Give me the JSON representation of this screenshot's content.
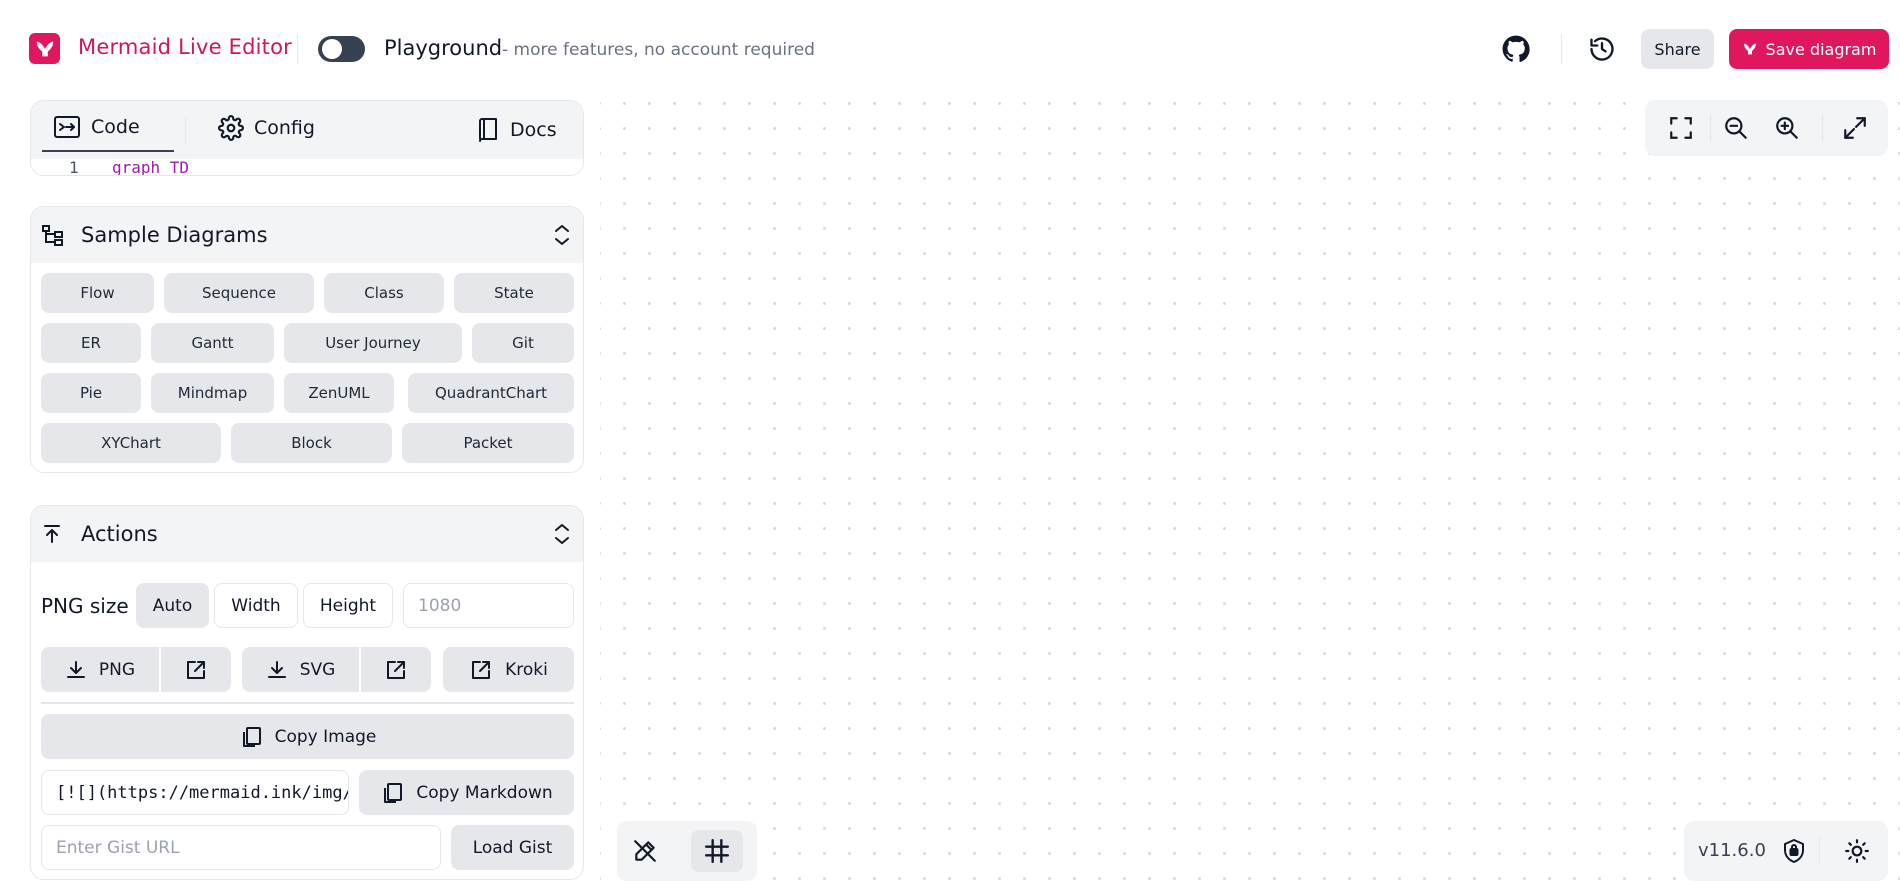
{
  "header": {
    "app_title": "Mermaid Live Editor",
    "playground_label": "Playground",
    "playground_sub": "- more features, no account required",
    "share_label": "Share",
    "save_label": "Save diagram"
  },
  "editor": {
    "tabs": [
      {
        "label": "Code"
      },
      {
        "label": "Config"
      }
    ],
    "docs_label": "Docs",
    "line_number": "1",
    "code_line": "graph TD"
  },
  "samples": {
    "title": "Sample Diagrams",
    "items": [
      "Flow",
      "Sequence",
      "Class",
      "State",
      "ER",
      "Gantt",
      "User Journey",
      "Git",
      "Pie",
      "Mindmap",
      "ZenUML",
      "QuadrantChart",
      "XYChart",
      "Block",
      "Packet"
    ]
  },
  "actions": {
    "title": "Actions",
    "png_size_label": "PNG size",
    "size_options": [
      "Auto",
      "Width",
      "Height"
    ],
    "size_placeholder": "1080",
    "png_label": "PNG",
    "svg_label": "SVG",
    "kroki_label": "Kroki",
    "copy_image_label": "Copy Image",
    "markdown_value": "[![](https://mermaid.ink/img/p",
    "copy_markdown_label": "Copy Markdown",
    "gist_placeholder": "Enter Gist URL",
    "load_gist_label": "Load Gist"
  },
  "footer": {
    "version": "v11.6.0"
  },
  "colors": {
    "brand": "#e0175e",
    "brand_text": "#d3155a",
    "chip_bg": "#e5e7eb",
    "panel_head_bg": "#f3f4f6"
  }
}
